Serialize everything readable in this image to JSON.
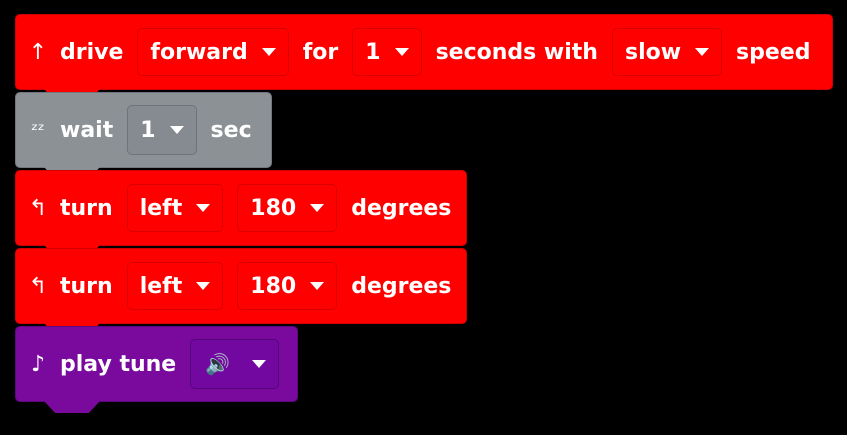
{
  "blocks": [
    {
      "id": "drive",
      "icon": "↑",
      "parts": [
        "drive",
        "forward",
        "for",
        "1",
        "seconds with",
        "slow",
        "speed"
      ]
    },
    {
      "id": "wait",
      "icon": "ᶻᶻ",
      "parts": [
        "wait",
        "1",
        "sec"
      ]
    },
    {
      "id": "turn1",
      "icon": "↰",
      "parts": [
        "turn",
        "left",
        "180",
        "degrees"
      ]
    },
    {
      "id": "turn2",
      "icon": "↰",
      "parts": [
        "turn",
        "left",
        "180",
        "degrees"
      ]
    },
    {
      "id": "tune",
      "icon": "♪",
      "label": "play tune",
      "tune_icon": "🔊"
    }
  ],
  "colors": {
    "drive": "#ff0000",
    "wait": "#8c9196",
    "turn": "#ff0000",
    "tune": "#7a0a9e"
  },
  "icons": {
    "drive": "arrow-up-icon",
    "wait": "sleep-icon",
    "turn": "turn-left-icon",
    "tune": "music-note-icon",
    "speaker": "speaker-icon"
  }
}
